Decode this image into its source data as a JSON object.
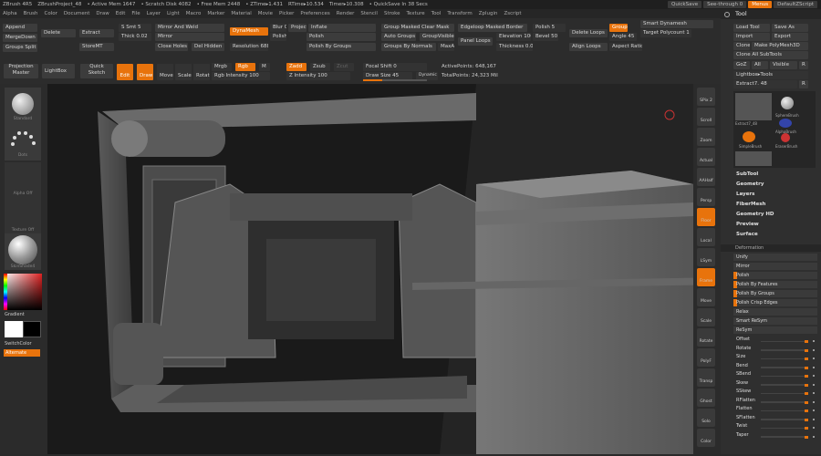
{
  "title_bar": {
    "app": "ZBrush 4R5",
    "project": "ZBrushProject_48",
    "active_mem": "• Active Mem 1647",
    "scratch_disk": "• Scratch Disk 4082",
    "free_mem": "• Free Mem 2448",
    "ztime": "• ZTime▸1.431",
    "rtime": "RTime▸10.534",
    "timer": "Timer▸10.308",
    "quicksave_info": "• QuickSave In 38 Secs",
    "quicksave": "QuickSave",
    "see_through": "See-through  0",
    "menus": "Menus",
    "default_script": "DefaultZScript"
  },
  "menu_bar": [
    "Alpha",
    "Brush",
    "Color",
    "Document",
    "Draw",
    "Edit",
    "File",
    "Layer",
    "Light",
    "Macro",
    "Marker",
    "Material",
    "Movie",
    "Picker",
    "Preferences",
    "Render",
    "Stencil",
    "Stroke",
    "Texture",
    "Tool",
    "Transform",
    "Zplugin",
    "Zscript"
  ],
  "toolbar": {
    "append": "Append",
    "delete": "Delete",
    "merge_down": "MergeDown",
    "extract": "Extract",
    "groups_split": "Groups Split",
    "store_mt": "StoreMT",
    "s_smt": "S Smt 5",
    "thick": "Thick 0.02",
    "mirror_weld": "Mirror And Weld",
    "mirror": "Mirror",
    "close_holes": "Close Holes",
    "del_hidden": "Del Hidden",
    "dynamesh": "DynaMesh",
    "resolution": "Resolution 688",
    "blur": "Blur 0",
    "polish": "Polish 0",
    "project": "Project",
    "inflate": "Inflate",
    "polish_btn": "Polish",
    "polish_by_groups": "Polish By Groups",
    "group_masked_clear": "Group Masked Clear Mask",
    "auto_groups": "Auto Groups",
    "group_visible": "GroupVisible",
    "groups_by_normals": "Groups By Normals",
    "max_ang": "MaxAn",
    "edgeloop": "Edgeloop Masked Border",
    "elevation": "Elevation 100",
    "bevel": "Bevel 50",
    "panel_loops": "Panel Loops",
    "thickness": "Thickness 0.01",
    "polish_5": "Polish 5",
    "angle": "Angle 45",
    "aspect_ratio": "Aspect Ratio",
    "delete_loops": "Delete Loops",
    "align_loops": "Align Loops",
    "group_btn": "Group",
    "smart_dynamesh": "Smart Dynamesh",
    "target_polycount": "Target Polycount 1",
    "projection_master": "Projection Master",
    "lightbox": "LightBox",
    "quick_sketch": "Quick Sketch",
    "edit": "Edit",
    "draw": "Draw",
    "move": "Move",
    "scale": "Scale",
    "rotate": "Rotate",
    "mrgb": "Mrgb",
    "rgb": "Rgb",
    "m": "M",
    "rgb_intensity": "Rgb Intensity 100",
    "zadd": "Zadd",
    "zsub": "Zsub",
    "zcut": "Zcut",
    "z_intensity": "Z Intensity 100",
    "focal_shift": "Focal Shift 0",
    "draw_size": "Draw Size 45",
    "dynamic": "Dynamic",
    "active_points": "ActivePoints: 648,167",
    "total_points": "TotalPoints: 24,323 Mil"
  },
  "left_shelf": {
    "brush_label": "Standard",
    "stroke_label": "Dots",
    "alpha_label": "Alpha Off",
    "texture_label": "Texture Off",
    "material_label": "SkinShade4",
    "gradient": "Gradient",
    "switch_color": "SwitchColor",
    "alternate": "Alternate"
  },
  "right_shelf": [
    "SPix 2",
    "Scroll",
    "Zoom",
    "Actual",
    "AAHalf",
    "Persp",
    "Floor",
    "Local",
    "LSym",
    "Frame",
    "Move",
    "Scale",
    "Rotate",
    "PolyF",
    "Transp",
    "Ghost",
    "Solo",
    "Color"
  ],
  "tool_panel": {
    "header": "Tool",
    "load_tool": "Load Tool",
    "save_as": "Save As",
    "import": "Import",
    "export": "Export",
    "clone": "Clone",
    "make_polymesh": "Make PolyMesh3D",
    "clone_all_subtools": "Clone All SubTools",
    "goz": "GoZ",
    "all": "All",
    "visible": "Visible",
    "r": "R",
    "lightbox_tools": "Lightbox▸Tools",
    "current_tool": "Extract7. 48",
    "tools": [
      "Extract7_48",
      "SphereBrush",
      "AlphaBrush",
      "SimpleBrush",
      "EraserBrush",
      "Extract7_48"
    ],
    "sections": [
      "SubTool",
      "Geometry",
      "Layers",
      "FiberMesh",
      "Geometry HD",
      "Preview",
      "Surface"
    ],
    "deformation_header": "Deformation",
    "deform_rows": [
      "Unify",
      "Mirror",
      "Polish",
      "Polish By Features",
      "Polish By Groups",
      "Polish Crisp Edges",
      "Relax",
      "Smart ReSym",
      "ReSym"
    ],
    "deform_sliders": [
      "Offset",
      "Rotate",
      "Size",
      "Bend",
      "SBend",
      "Skew",
      "SSkew",
      "RFlatten",
      "Flatten",
      "SFlatten",
      "Twist",
      "Taper"
    ]
  },
  "colors": {
    "accent": "#e8730c",
    "panel": "#2f2f2f",
    "button": "#3c3c3c",
    "viewport": "#161616"
  }
}
